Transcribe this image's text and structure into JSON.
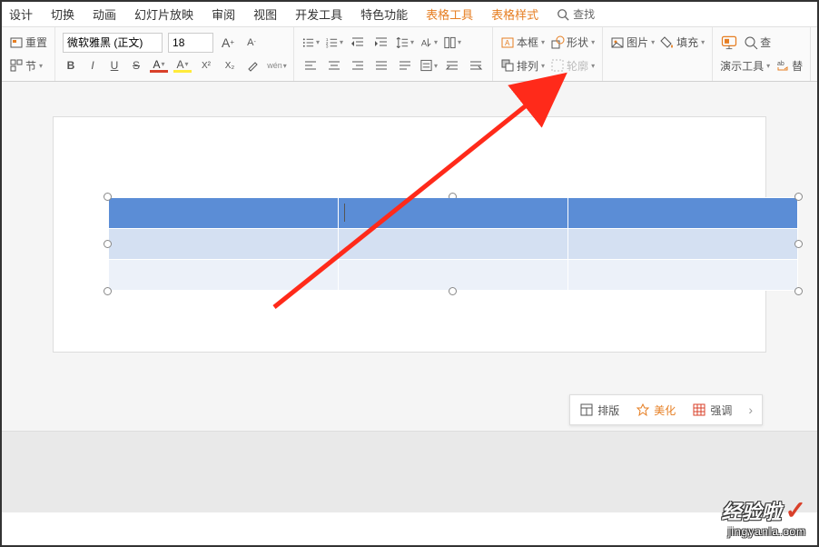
{
  "menu": {
    "items": [
      "设计",
      "切换",
      "动画",
      "幻灯片放映",
      "审阅",
      "视图",
      "开发工具",
      "特色功能"
    ],
    "accent_items": [
      "表格工具",
      "表格样式"
    ],
    "search": "查找"
  },
  "ribbon": {
    "reset": "重置",
    "section": "节",
    "font_name": "微软雅黑 (正文)",
    "font_size": "18",
    "textbox": "本框",
    "shape": "形状",
    "arrange": "排列",
    "outline": "轮廓",
    "picture": "图片",
    "fill": "填充",
    "present": "演示工具",
    "replace": "替",
    "find2": "查"
  },
  "float": {
    "layout": "排版",
    "beautify": "美化",
    "emphasis": "强调"
  },
  "watermark": {
    "main": "经验啦",
    "sub": "jingyanla.com"
  }
}
